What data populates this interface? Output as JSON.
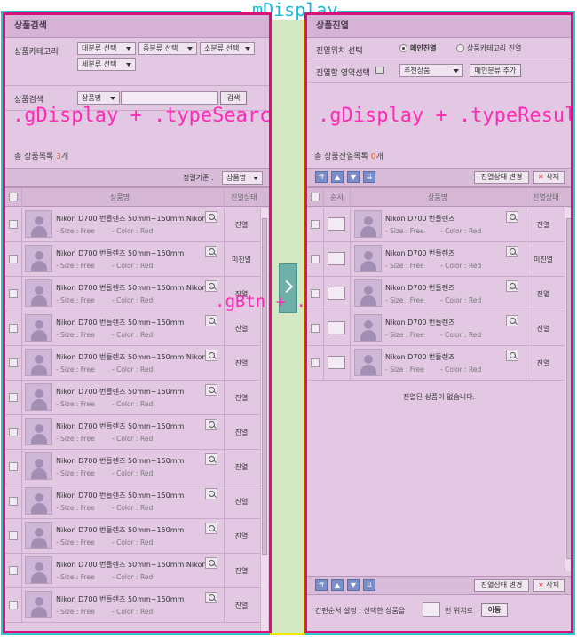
{
  "annotations": {
    "container": ".mDisplay",
    "left_overlay": ".gDisplay + .typeSearch",
    "right_overlay": ".gDisplay + .typeResult",
    "add_button": ".gBtn + .prdAdd"
  },
  "left": {
    "title": "상품검색",
    "category_label": "상품카테고리",
    "category_selects": [
      "대분류 선택",
      "중분류 선택",
      "소분류 선택",
      "세분류 선택"
    ],
    "search_label": "상품검색",
    "search_type": "상품명",
    "search_value": "",
    "search_button": "검색",
    "count_prefix": "총 상품목록",
    "count_value": "3",
    "count_suffix": "개",
    "sort_label": "정렬기준 :",
    "sort_value": "상품명",
    "col_name": "상품명",
    "col_status": "진열상태",
    "items": [
      {
        "name": "Nikon D700 번들렌즈 50mm~150mm Nikon",
        "size": "- Size : Free",
        "color": "- Color : Red",
        "status": "진열"
      },
      {
        "name": "Nikon D700 번들렌즈 50mm~150mm",
        "size": "- Size : Free",
        "color": "- Color : Red",
        "status": "미진열"
      },
      {
        "name": "Nikon D700 번들렌즈 50mm~150mm Nikon",
        "size": "- Size : Free",
        "color": "- Color : Red",
        "status": "진열"
      },
      {
        "name": "Nikon D700 번들렌즈 50mm~150mm",
        "size": "- Size : Free",
        "color": "- Color : Red",
        "status": "진열"
      },
      {
        "name": "Nikon D700 번들렌즈 50mm~150mm Nikon",
        "size": "- Size : Free",
        "color": "- Color : Red",
        "status": "진열"
      },
      {
        "name": "Nikon D700 번들렌즈 50mm~150mm",
        "size": "- Size : Free",
        "color": "- Color : Red",
        "status": "진열"
      },
      {
        "name": "Nikon D700 번들렌즈 50mm~150mm",
        "size": "- Size : Free",
        "color": "- Color : Red",
        "status": "진열"
      },
      {
        "name": "Nikon D700 번들렌즈 50mm~150mm",
        "size": "- Size : Free",
        "color": "- Color : Red",
        "status": "진열"
      },
      {
        "name": "Nikon D700 번들렌즈 50mm~150mm",
        "size": "- Size : Free",
        "color": "- Color : Red",
        "status": "진열"
      },
      {
        "name": "Nikon D700 번들렌즈 50mm~150mm",
        "size": "- Size : Free",
        "color": "- Color : Red",
        "status": "진열"
      },
      {
        "name": "Nikon D700 번들렌즈 50mm~150mm Nikon",
        "size": "- Size : Free",
        "color": "- Color : Red",
        "status": "진열"
      },
      {
        "name": "Nikon D700 번들렌즈 50mm~150mm",
        "size": "- Size : Free",
        "color": "- Color : Red",
        "status": "진열"
      }
    ]
  },
  "right": {
    "title": "상품진열",
    "position_label": "진열위치 선택",
    "radio_main": "메인진열",
    "radio_category": "상품카테고리 진열",
    "area_label": "진열할 영역선택",
    "area_value": "추천상품",
    "add_main_button": "메인분류 추가",
    "count_prefix": "총 상품진열목록",
    "count_value": "0",
    "count_suffix": "개",
    "status_change": "진열상태 변경",
    "delete_label": "삭제",
    "col_order": "순서",
    "col_name": "상품명",
    "col_status": "진열상태",
    "items": [
      {
        "name": "Nikon D700 번들렌즈",
        "size": "- Size : Free",
        "color": "- Color : Red",
        "status": "진열"
      },
      {
        "name": "Nikon D700 번들렌즈",
        "size": "- Size : Free",
        "color": "- Color : Red",
        "status": "미진열"
      },
      {
        "name": "Nikon D700 번들렌즈",
        "size": "- Size : Free",
        "color": "- Color : Red",
        "status": "진열"
      },
      {
        "name": "Nikon D700 번들렌즈",
        "size": "- Size : Free",
        "color": "- Color : Red",
        "status": "진열"
      },
      {
        "name": "Nikon D700 번들렌즈",
        "size": "- Size : Free",
        "color": "- Color : Red",
        "status": "진열"
      }
    ],
    "empty_message": "진열된 상품이 없습니다.",
    "move_label_pre": "간편순서 설정 : 선택한 상품을",
    "move_label_post": "번 위치로",
    "move_button": "이동"
  }
}
